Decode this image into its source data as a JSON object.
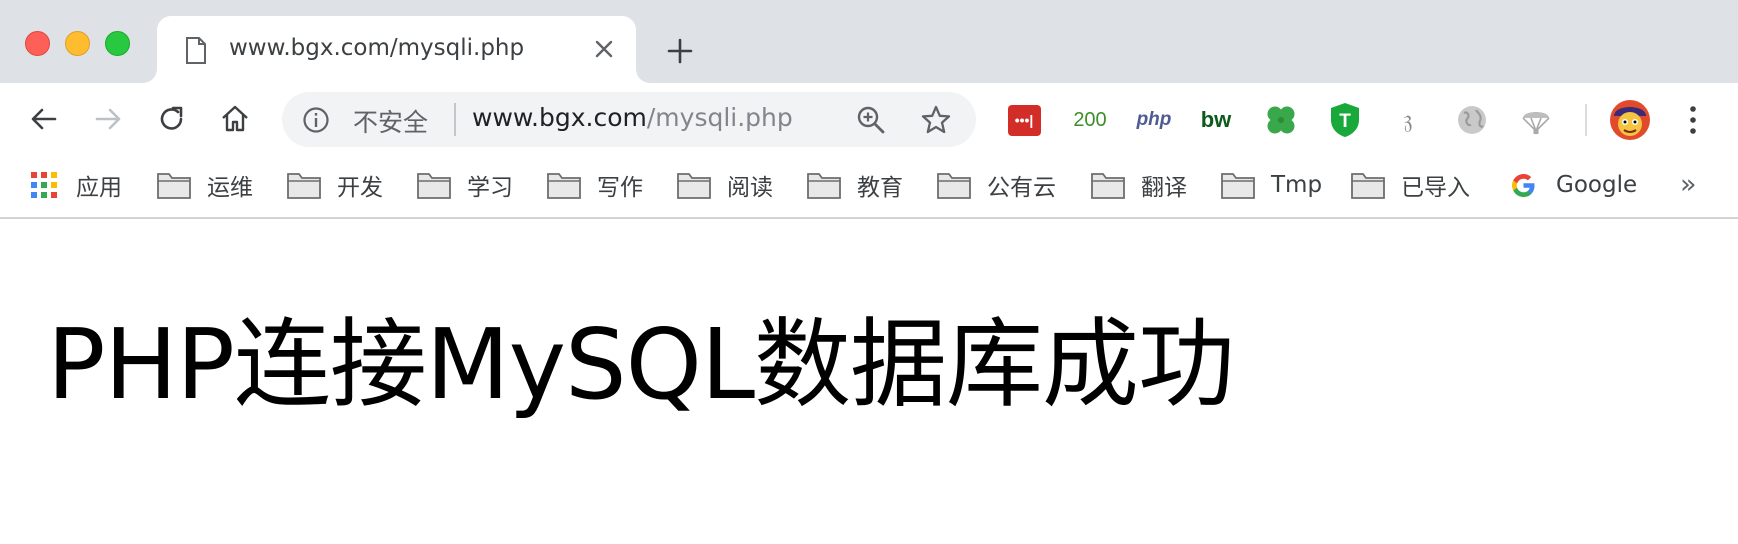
{
  "window": {
    "traffic_lights": [
      "close",
      "minimize",
      "zoom"
    ]
  },
  "tab": {
    "title": "www.bgx.com/mysqli.php",
    "icon": "page-icon"
  },
  "toolbar": {
    "back_icon": "back-arrow-icon",
    "forward_icon": "forward-arrow-icon",
    "reload_icon": "reload-icon",
    "home_icon": "home-icon"
  },
  "omnibox": {
    "security_label": "不安全",
    "url_host": "www.bgx.com",
    "url_path": "/mysqli.php"
  },
  "extensions": [
    {
      "name": "lastpass",
      "label": "•••|"
    },
    {
      "name": "status-code",
      "label": "200"
    },
    {
      "name": "php-docs",
      "label": "php"
    },
    {
      "name": "bw",
      "label": "bw"
    },
    {
      "name": "clover",
      "label": ""
    },
    {
      "name": "tampermonkey",
      "label": "T"
    },
    {
      "name": "calligraphy",
      "label": "𝔷"
    },
    {
      "name": "globe",
      "label": ""
    },
    {
      "name": "parachute",
      "label": ""
    }
  ],
  "bookmarks": {
    "apps_label": "应用",
    "folders": [
      "运维",
      "开发",
      "学习",
      "写作",
      "阅读",
      "教育",
      "公有云",
      "翻译",
      "Tmp",
      "已导入"
    ],
    "google_label": "Google",
    "more_label": "»"
  },
  "page": {
    "heading": "PHP连接MySQL数据库成功"
  },
  "colors": {
    "tabstrip": "#dee1e6",
    "omnibox": "#f1f3f4",
    "close_light": "#fe5f57",
    "minimize_light": "#febc2e",
    "zoom_light": "#28c840"
  }
}
